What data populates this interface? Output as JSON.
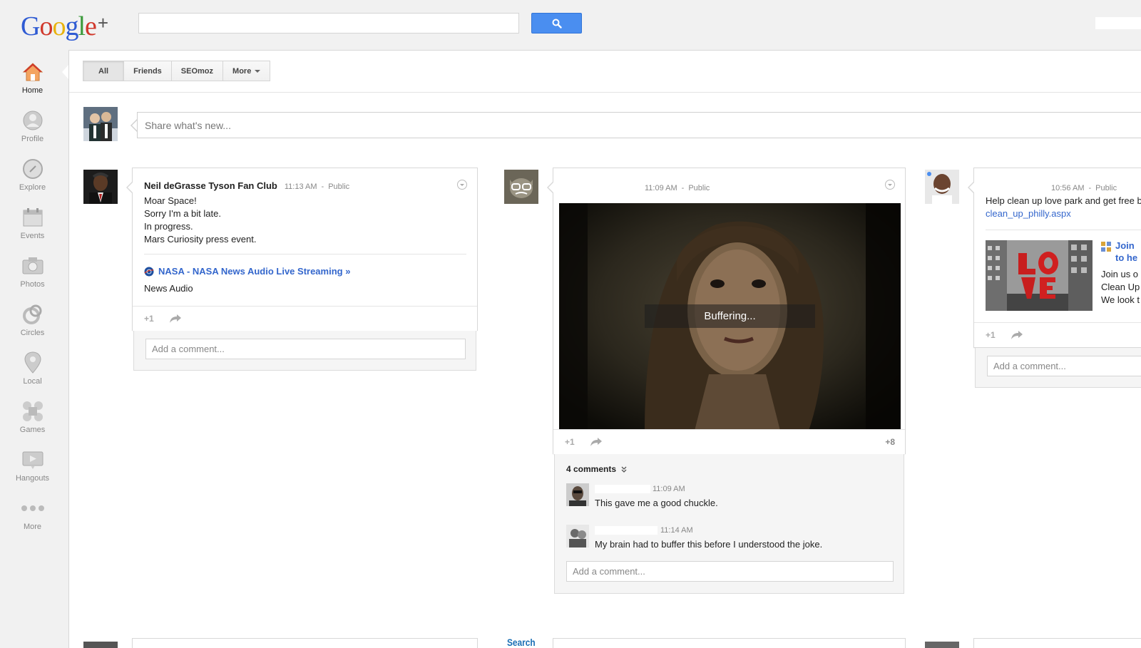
{
  "header": {
    "logo": {
      "g": "G",
      "o1": "o",
      "o2": "o",
      "g2": "g",
      "l": "l",
      "e": "e",
      "plus": "+"
    },
    "search": {
      "value": "",
      "placeholder": ""
    }
  },
  "sidebar": {
    "items": [
      {
        "label": "Home",
        "icon": "home-icon"
      },
      {
        "label": "Profile",
        "icon": "profile-icon"
      },
      {
        "label": "Explore",
        "icon": "compass-icon"
      },
      {
        "label": "Events",
        "icon": "calendar-icon"
      },
      {
        "label": "Photos",
        "icon": "camera-icon"
      },
      {
        "label": "Circles",
        "icon": "circles-icon"
      },
      {
        "label": "Local",
        "icon": "map-pin-icon"
      },
      {
        "label": "Games",
        "icon": "games-icon"
      },
      {
        "label": "Hangouts",
        "icon": "video-icon"
      },
      {
        "label": "More",
        "icon": "more-dots-icon"
      }
    ]
  },
  "filters": {
    "all": "All",
    "friends": "Friends",
    "seomoz": "SEOmoz",
    "more": "More"
  },
  "share": {
    "placeholder": "Share what's new..."
  },
  "posts": [
    {
      "author": "Neil deGrasse Tyson Fan Club",
      "time": "11:13 AM",
      "sep": "-",
      "visibility": "Public",
      "lines": [
        "Moar Space!",
        "Sorry I'm a bit late.",
        "In progress.",
        "Mars Curiosity press event."
      ],
      "link_title": "NASA - NASA News Audio Live Streaming »",
      "link_desc": "News Audio",
      "plus_one": "+1",
      "comment_placeholder": "Add a comment..."
    },
    {
      "author": "",
      "time": "11:09 AM",
      "sep": "-",
      "visibility": "Public",
      "video_status": "Buffering...",
      "plus_one": "+1",
      "plus_count": "+8",
      "comments_count": "4 comments",
      "comments": [
        {
          "time": "11:09 AM",
          "text": "This gave me a good chuckle."
        },
        {
          "time": "11:14 AM",
          "text": "My brain had to buffer this before I understood the joke."
        }
      ],
      "comment_placeholder": "Add a comment..."
    },
    {
      "author": "",
      "time": "10:56 AM",
      "sep": "-",
      "visibility": "Public",
      "text": "Help clean up love park and get free b",
      "link": "clean_up_philly.aspx",
      "attach_title_1": "Join",
      "attach_title_2": "to he",
      "attach_lines": [
        "Join us o",
        "Clean Up",
        "We look t"
      ],
      "plus_one": "+1",
      "comment_placeholder": "Add a comment..."
    }
  ],
  "bottom": {
    "search_label": "Search"
  }
}
